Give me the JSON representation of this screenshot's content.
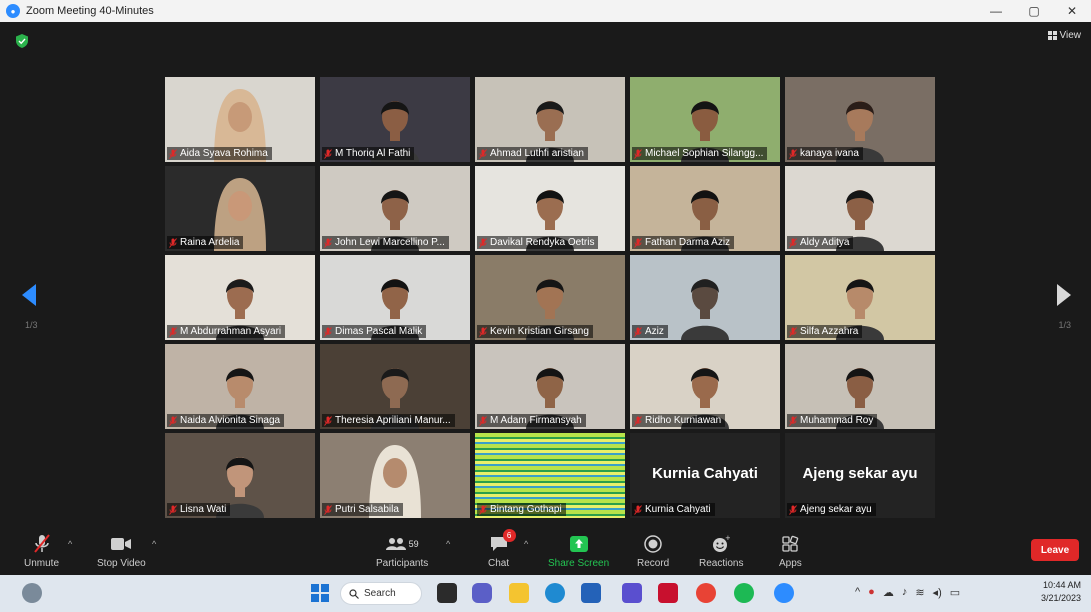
{
  "window": {
    "title": "Zoom Meeting 40-Minutes",
    "controls": [
      "—",
      "▢",
      "✕"
    ]
  },
  "meeting": {
    "view_label": "View",
    "page_left": "1/3",
    "page_right": "1/3",
    "participants": [
      {
        "name": "Aida Syava Rohima",
        "video": true,
        "bg": "#d9d6cf",
        "skin": "#c79a78",
        "hair": "#3a2a22",
        "hijab": true,
        "hijab_color": "#d8b896",
        "muted": true
      },
      {
        "name": "M Thoriq Al Fathi",
        "video": true,
        "bg": "#3c3a44",
        "skin": "#8b5e44",
        "hair": "#151515",
        "muted": true
      },
      {
        "name": "Ahmad Luthfi aristian",
        "video": true,
        "bg": "#c7c2b8",
        "skin": "#9a6e52",
        "hair": "#1a1a1a",
        "muted": true
      },
      {
        "name": "Michael Sophian Silangg...",
        "video": true,
        "bg": "#8fae6e",
        "skin": "#8a5c40",
        "hair": "#141414",
        "muted": true
      },
      {
        "name": "kanaya ivana",
        "video": true,
        "bg": "#7a6e64",
        "skin": "#a77a5c",
        "hair": "#2a1d18",
        "muted": true
      },
      {
        "name": "Raina Ardelia",
        "video": true,
        "bg": "#2b2b2b",
        "skin": "#c99878",
        "hair": "#2b1e18",
        "hijab": true,
        "hijab_color": "#bda182",
        "muted": true
      },
      {
        "name": "John Lewi Marcellino P...",
        "video": true,
        "bg": "#cfcac2",
        "skin": "#8e6248",
        "hair": "#151515",
        "muted": true
      },
      {
        "name": "Davikal Rendyka Oetris",
        "video": true,
        "bg": "#e6e4df",
        "skin": "#9b6d50",
        "hair": "#121212",
        "muted": true
      },
      {
        "name": "Fathan Darma Aziz",
        "video": true,
        "bg": "#c5b49a",
        "skin": "#8a5f44",
        "hair": "#121212",
        "muted": true
      },
      {
        "name": "Aldy Aditya",
        "video": true,
        "bg": "#dcd8d1",
        "skin": "#8c6046",
        "hair": "#151515",
        "muted": true
      },
      {
        "name": "M Abdurrahman Asyari",
        "video": true,
        "bg": "#e4e0d8",
        "skin": "#9c6c50",
        "hair": "#1b1b1b",
        "muted": true
      },
      {
        "name": "Dimas Pascal Malik",
        "video": true,
        "bg": "#d9d9d7",
        "skin": "#916448",
        "hair": "#121212",
        "muted": true
      },
      {
        "name": "Kevin Kristian Girsang",
        "video": true,
        "bg": "#8a7c68",
        "skin": "#a27454",
        "hair": "#151515",
        "muted": true
      },
      {
        "name": "Aziz",
        "video": true,
        "bg": "#b9c2c8",
        "skin": "#5a4a40",
        "hair": "#202020",
        "muted": true
      },
      {
        "name": "Silfa Azzahra",
        "video": true,
        "bg": "#d2c7a4",
        "skin": "#b78a6a",
        "hair": "#151515",
        "muted": true
      },
      {
        "name": "Naida Alvionita Sinaga",
        "video": true,
        "bg": "#bfb3a6",
        "skin": "#b88b6c",
        "hair": "#151515",
        "muted": true
      },
      {
        "name": "Theresia Apriliani Manur...",
        "video": true,
        "bg": "#4b4036",
        "skin": "#8e6a52",
        "hair": "#1a1a1a",
        "muted": true
      },
      {
        "name": "M Adam Firmansyah",
        "video": true,
        "bg": "#c9c4bd",
        "skin": "#8f6447",
        "hair": "#141414",
        "muted": true
      },
      {
        "name": "Ridho Kurniawan",
        "video": true,
        "bg": "#d9d2c6",
        "skin": "#9a6a4c",
        "hair": "#151515",
        "muted": true
      },
      {
        "name": "Muhammad Roy",
        "video": true,
        "bg": "#c6c0b6",
        "skin": "#8a5e44",
        "hair": "#141414",
        "muted": true
      },
      {
        "name": "Lisna Wati",
        "video": true,
        "bg": "#5e5248",
        "skin": "#c1957a",
        "hair": "#151515",
        "muted": true
      },
      {
        "name": "Putri Salsabila",
        "video": true,
        "bg": "#8c7f72",
        "skin": "#b58b6e",
        "hair": "#3a2c24",
        "hijab": true,
        "hijab_color": "#e9e2d5",
        "muted": true
      },
      {
        "name": "Bintang Gothapi",
        "video": true,
        "glitch": true,
        "muted": true
      },
      {
        "name": "Kurnia Cahyati",
        "video": false,
        "muted": true
      },
      {
        "name": "Ajeng sekar ayu",
        "video": false,
        "muted": true
      }
    ]
  },
  "controls": {
    "unmute_label": "Unmute",
    "stop_video_label": "Stop Video",
    "participants_label": "Participants",
    "participants_count": "59",
    "chat_label": "Chat",
    "chat_badge": "6",
    "share_label": "Share Screen",
    "record_label": "Record",
    "reactions_label": "Reactions",
    "apps_label": "Apps",
    "leave_label": "Leave",
    "share_color": "#23c552",
    "leave_color": "#e02828"
  },
  "taskbar": {
    "search_placeholder": "Search",
    "time": "10:44 AM",
    "date": "3/21/2023",
    "icons": [
      "widgets-icon",
      "start-icon",
      "search-icon",
      "file-explorer-icon",
      "teams-icon",
      "folder-icon",
      "chrome-icon",
      "store-icon",
      "photos-icon",
      "mcafee-icon",
      "chrome-icon",
      "spotify-icon",
      "zoom-icon"
    ]
  }
}
